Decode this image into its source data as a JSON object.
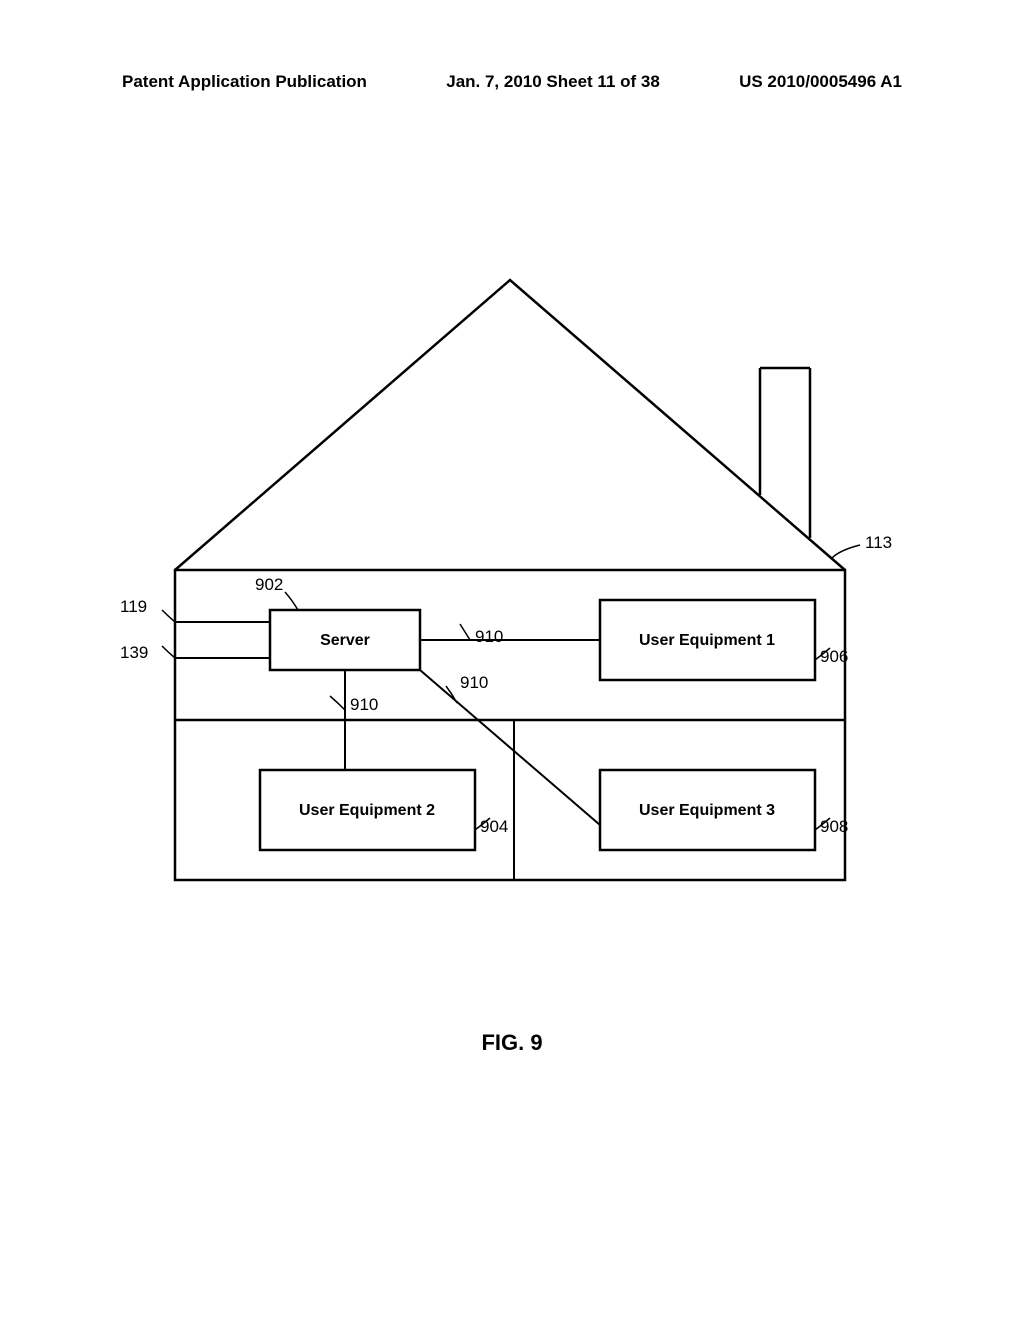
{
  "header": {
    "left": "Patent Application Publication",
    "center": "Jan. 7, 2010  Sheet 11 of 38",
    "right": "US 2010/0005496 A1"
  },
  "boxes": {
    "server": "Server",
    "ue1": "User Equipment 1",
    "ue2": "User Equipment 2",
    "ue3": "User Equipment 3"
  },
  "refs": {
    "r113": "113",
    "r119": "119",
    "r139": "139",
    "r902": "902",
    "r904": "904",
    "r906": "906",
    "r908": "908",
    "r910a": "910",
    "r910b": "910",
    "r910c": "910"
  },
  "figure_caption": "FIG. 9"
}
